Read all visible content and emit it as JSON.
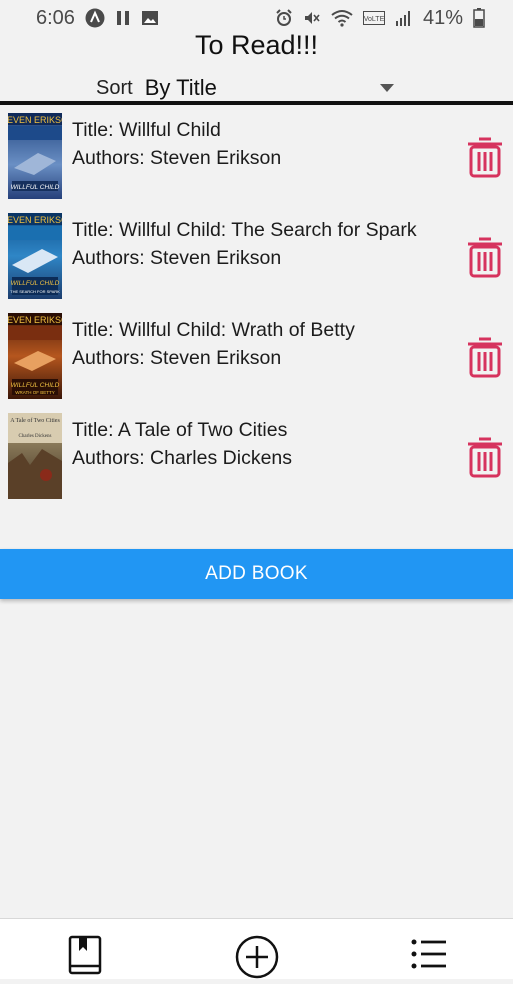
{
  "status_bar": {
    "time": "6:06",
    "battery": "41%",
    "icons": [
      "a-icon",
      "pause-icon",
      "image-icon",
      "alarm-icon",
      "mute-icon",
      "wifi-icon",
      "volte-icon",
      "signal-icon",
      "battery-icon"
    ]
  },
  "page": {
    "title": "To Read!!!"
  },
  "sort": {
    "label": "Sort",
    "selected": "By Title"
  },
  "books": [
    {
      "title": "Title: Willful Child",
      "authors": "Authors: Steven Erikson",
      "cover_author": "STEVEN ERIKSON",
      "cover_title": "WILLFUL CHILD",
      "cover_sub": ""
    },
    {
      "title": "Title: Willful Child: The Search for Spark",
      "authors": "Authors: Steven Erikson",
      "cover_author": "STEVEN ERIKSON",
      "cover_title": "WILLFUL CHILD",
      "cover_sub": "THE SEARCH FOR SPARK"
    },
    {
      "title": "Title: Willful Child: Wrath of Betty",
      "authors": "Authors: Steven Erikson",
      "cover_author": "STEVEN ERIKSON",
      "cover_title": "WILLFUL CHILD",
      "cover_sub": "WRATH OF BETTY"
    },
    {
      "title": "Title: A Tale of Two Cities",
      "authors": "Authors: Charles Dickens",
      "cover_author": "Charles Dickens",
      "cover_title": "A Tale of Two Cities",
      "cover_sub": ""
    }
  ],
  "actions": {
    "add_book": "ADD BOOK"
  },
  "colors": {
    "accent": "#2196f3",
    "delete": "#d6335e",
    "background": "#f2f2f2"
  },
  "bottom_nav": [
    {
      "name": "to-read-tab",
      "icon": "bookmark-book-icon"
    },
    {
      "name": "add-tab",
      "icon": "plus-circle-icon"
    },
    {
      "name": "list-tab",
      "icon": "list-icon"
    }
  ]
}
